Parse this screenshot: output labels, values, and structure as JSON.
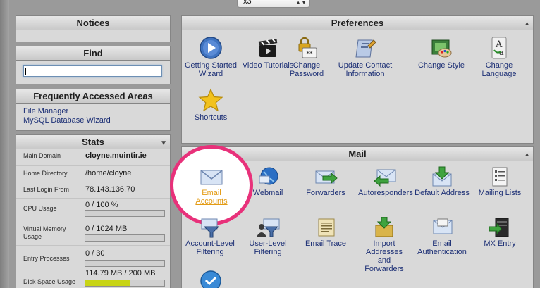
{
  "theme": {
    "selected": "x3"
  },
  "notices": {
    "title": "Notices"
  },
  "find": {
    "title": "Find",
    "value": ""
  },
  "frequent": {
    "title": "Frequently Accessed Areas",
    "links": [
      "File Manager",
      "MySQL Database Wizard"
    ]
  },
  "stats": {
    "title": "Stats",
    "rows": [
      {
        "label": "Main Domain",
        "value": "cloyne.muintir.ie"
      },
      {
        "label": "Home Directory",
        "value": "/home/cloyne"
      },
      {
        "label": "Last Login From",
        "value": "78.143.136.70"
      },
      {
        "label": "CPU Usage",
        "value": "0 / 100 %",
        "progress": 0
      },
      {
        "label": "Virtual Memory Usage",
        "value": "0 / 1024 MB",
        "progress": 0
      },
      {
        "label": "Entry Processes",
        "value": "0 / 30",
        "progress": 0
      },
      {
        "label": "Disk Space Usage",
        "value": "114.79 MB / 200 MB",
        "progress": 0.574
      }
    ]
  },
  "preferences": {
    "title": "Preferences",
    "items": [
      {
        "label": "Getting Started Wizard",
        "icon": "play-icon"
      },
      {
        "label": "Video Tutorials",
        "icon": "film-clapper-icon"
      },
      {
        "label": "Change Password",
        "icon": "lock-password-icon"
      },
      {
        "label": "Update Contact Information",
        "icon": "contact-card-icon"
      },
      {
        "label": "Change Style",
        "icon": "paint-palette-icon"
      },
      {
        "label": "Change Language",
        "icon": "language-letters-icon"
      },
      {
        "label": "Shortcuts",
        "icon": "star-icon"
      }
    ]
  },
  "mail": {
    "title": "Mail",
    "items": [
      {
        "label": "Email Accounts",
        "icon": "envelope-icon"
      },
      {
        "label": "Webmail",
        "icon": "globe-icon"
      },
      {
        "label": "Forwarders",
        "icon": "forward-arrow-icon"
      },
      {
        "label": "Autoresponders",
        "icon": "reply-envelope-icon"
      },
      {
        "label": "Default Address",
        "icon": "download-arrow-icon"
      },
      {
        "label": "Mailing Lists",
        "icon": "list-icon"
      },
      {
        "label": "Account-Level Filtering",
        "icon": "funnel-icon"
      },
      {
        "label": "User-Level Filtering",
        "icon": "user-funnel-icon"
      },
      {
        "label": "Email Trace",
        "icon": "scroll-icon"
      },
      {
        "label": "Import Addresses and Forwarders",
        "icon": "import-box-icon"
      },
      {
        "label": "Email Authentication",
        "icon": "key-envelope-icon"
      },
      {
        "label": "MX Entry",
        "icon": "server-icon"
      }
    ]
  },
  "colors": {
    "link": "#1c2f75",
    "highlight_ring": "#e8317a",
    "highlight_text": "#e39b14",
    "disk_fill": "#c8d415"
  }
}
